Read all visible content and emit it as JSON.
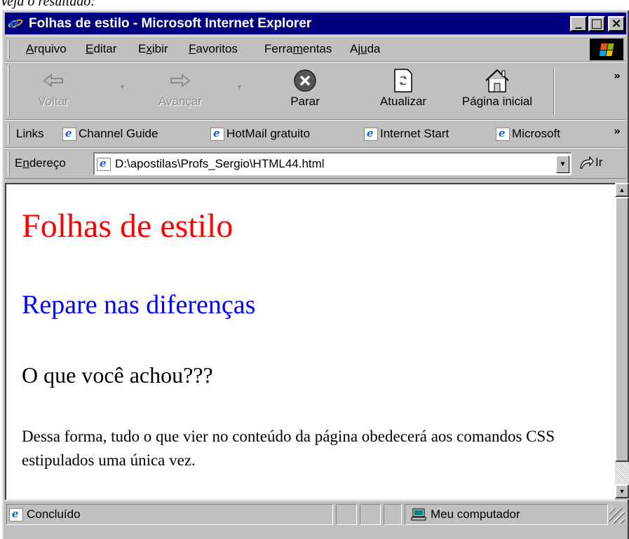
{
  "caption": "Veja o resultado:",
  "window": {
    "title": "Folhas de estilo - Microsoft Internet Explorer",
    "min": "_",
    "max": "□",
    "close": "×"
  },
  "menu": [
    {
      "pre": "",
      "key": "A",
      "post": "rquivo"
    },
    {
      "pre": "",
      "key": "E",
      "post": "ditar"
    },
    {
      "pre": "E",
      "key": "x",
      "post": "ibir"
    },
    {
      "pre": "",
      "key": "F",
      "post": "avoritos"
    },
    {
      "pre": "Ferra",
      "key": "m",
      "post": "entas"
    },
    {
      "pre": "Aj",
      "key": "u",
      "post": "da"
    }
  ],
  "toolbar": {
    "back": "Voltar",
    "forward": "Avançar",
    "stop": "Parar",
    "refresh": "Atualizar",
    "home": "Página inicial",
    "more": "»"
  },
  "links": {
    "label": "Links",
    "items": [
      "Channel Guide",
      "HotMail gratuito",
      "Internet Start",
      "Microsoft"
    ],
    "more": "»"
  },
  "address": {
    "label_pre": "E",
    "label_key": "n",
    "label_post": "dereço",
    "value": "D:\\apostilas\\Profs_Sergio\\HTML44.html",
    "go": "Ir"
  },
  "page": {
    "h1": "Folhas de estilo",
    "h2": "Repare nas diferenças",
    "h3": "O que você achou???",
    "p": "Dessa forma, tudo o que vier no conteúdo da página obedecerá aos comandos CSS estipulados uma única vez."
  },
  "status": {
    "text": "Concluído",
    "zone": "Meu computador"
  },
  "colors": {
    "title_bg": "#000080",
    "h1": "#ff0000",
    "h2": "#0000ff"
  }
}
